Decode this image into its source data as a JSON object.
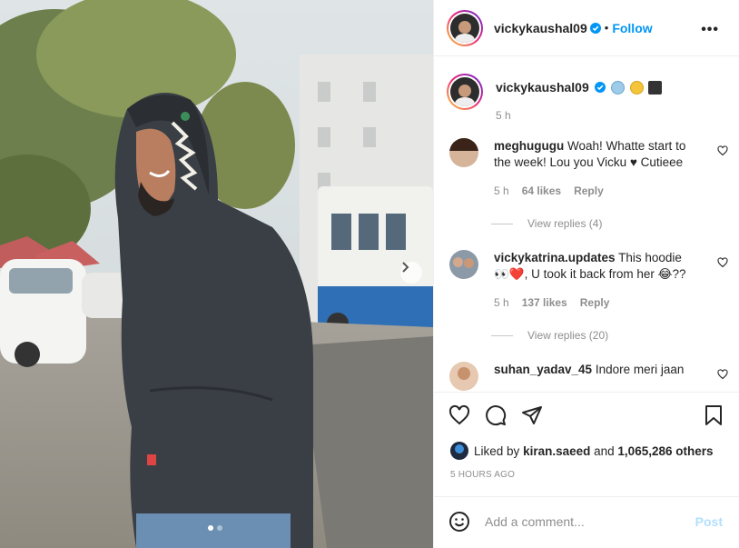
{
  "post": {
    "author": "vickykaushal09",
    "follow_label": "Follow",
    "separator": "•",
    "more_label": "•••",
    "caption_time": "5 h",
    "caption_emojis": [
      "cold-face-emoji",
      "woozy-face-emoji",
      "clapper-board-emoji"
    ]
  },
  "comments": [
    {
      "username": "meghugugu",
      "text": "Woah! Whatte start to the week! Lou you Vicku ♥ Cutieee",
      "time": "5 h",
      "likes": "64 likes",
      "reply": "Reply",
      "view_replies": "View replies (4)"
    },
    {
      "username": "vickykatrina.updates",
      "text_before": "This hoodie",
      "text_emojis": "👀❤️",
      "text_after": ", U took it back from her 😂??",
      "time": "5 h",
      "likes": "137 likes",
      "reply": "Reply",
      "view_replies": "View replies (20)"
    },
    {
      "username": "suhan_yadav_45",
      "text": "Indore meri jaan"
    }
  ],
  "likes": {
    "prefix": "Liked by",
    "user": "kiran.saeed",
    "and": "and",
    "count": "1,065,286 others"
  },
  "post_time": "5 HOURS AGO",
  "add_comment": {
    "placeholder": "Add a comment...",
    "post_label": "Post"
  },
  "carousel": {
    "current": 1,
    "total": 2
  },
  "colors": {
    "accent": "#0095f6",
    "post_disabled": "#b2dffc",
    "muted": "#8e8e8e"
  }
}
